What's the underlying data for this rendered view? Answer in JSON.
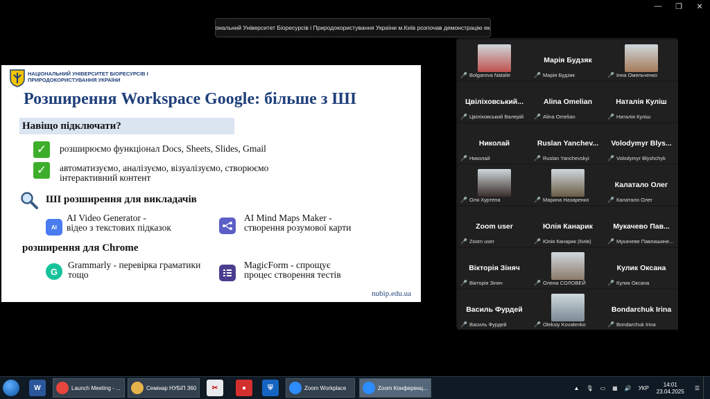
{
  "window": {
    "minimize": "—",
    "restore": "❐",
    "close": "✕"
  },
  "share_banner": {
    "text": "Національний Університет Біоресурсів і Природокористування України м.Київ розпочав демонстрацію екрана"
  },
  "slide": {
    "university": "НАЦІОНАЛЬНИЙ УНІВЕРСИТЕТ БІОРЕСУРСІВ І ПРИРОДОКОРИСТУВАННЯ УКРАЇНИ",
    "title": "Розширення Workspace Google: більше з ШІ",
    "why_heading": "Навіщо підключати?",
    "bullets": [
      {
        "text": "розширюємо функціонал Docs, Sheets, Slides, Gmail"
      },
      {
        "text": "автоматизуємо, аналізуємо, візуалізуємо, створюємо інтерактивний контент"
      }
    ],
    "teachers_heading": "ШІ розширення для викладачів",
    "extensions": [
      {
        "name": "AI Video Generator -",
        "desc": "відео з текстових підказок",
        "icon": "AI"
      },
      {
        "name": "AI Mind Maps Maker -",
        "desc": "створення розумової карти",
        "icon": "map"
      }
    ],
    "chrome_heading": "розширення для Chrome",
    "chrome_extensions": [
      {
        "name": "Grammarly - перевірка граматики",
        "desc": "тощо",
        "icon": "G"
      },
      {
        "name": "MagicForm - спрощує",
        "desc": "процес створення тестів",
        "icon": "form"
      }
    ],
    "url": "nubip.edu.ua",
    "accent_color": "#1f3f7a"
  },
  "gallery": {
    "participants": [
      {
        "name": "",
        "label": "Bolgarova Natalie",
        "photo": true,
        "photo_color": "#c0504d"
      },
      {
        "name": "Марія Будзяк",
        "label": "Марія Будзяк",
        "photo": false
      },
      {
        "name": "",
        "label": "Інна Омельченко",
        "photo": true,
        "photo_color": "#a57a5a"
      },
      {
        "name": "Цвіліховський...",
        "label": "Цвіліховський Валерій",
        "photo": false
      },
      {
        "name": "Alina Omelian",
        "label": "Alina Omelian",
        "photo": false
      },
      {
        "name": "Наталія Куліш",
        "label": "Наталія Куліш",
        "photo": false
      },
      {
        "name": "Николай",
        "label": "Николай",
        "photo": false
      },
      {
        "name": "Ruslan Yanchev...",
        "label": "Ruslan Yanchevskyi",
        "photo": false
      },
      {
        "name": "Volodymyr Blys...",
        "label": "Volodymyr Blyshchyk",
        "photo": false
      },
      {
        "name": "",
        "label": "Оля Хуртепа",
        "photo": true,
        "photo_color": "#3a2e2a"
      },
      {
        "name": "",
        "label": "Марина Назаренко",
        "photo": true,
        "photo_color": "#6b5b45"
      },
      {
        "name": "Калатало Олег",
        "label": "Калатало Олег",
        "photo": false
      },
      {
        "name": "Zoom user",
        "label": "Zoom user",
        "photo": false
      },
      {
        "name": "Юлія Канарик",
        "label": "Юлія Канарик (Київ)",
        "photo": false
      },
      {
        "name": "Мукачево Пав...",
        "label": "Мукачеве Павлишине...",
        "photo": false
      },
      {
        "name": "Вікторія Зіняч",
        "label": "Вікторія Зіняч",
        "photo": false
      },
      {
        "name": "",
        "label": "Олена СОЛОВЕЙ",
        "photo": true,
        "photo_color": "#8c7a6a"
      },
      {
        "name": "Кулик Оксана",
        "label": "Кулик Оксана",
        "photo": false
      },
      {
        "name": "Василь Фурдей",
        "label": "Василь Фурдей",
        "photo": false
      },
      {
        "name": "",
        "label": "Oleksiy Kovalenko",
        "photo": true,
        "photo_color": "#7a8a96"
      },
      {
        "name": "Bondarchuk Irina",
        "label": "Bondarchuk Irina",
        "photo": false
      }
    ]
  },
  "taskbar": {
    "buttons": [
      {
        "label": "Launch Meeting - ...",
        "icon": "chrome-icon",
        "color": "#e8453c",
        "active": false
      },
      {
        "label": "Семінар НУБіП 360",
        "icon": "folder-icon",
        "color": "#e6b34a",
        "active": false
      },
      {
        "label": "Zoom Workplace",
        "icon": "zoom-icon",
        "color": "#2d8cff",
        "active": false
      },
      {
        "label": "Zoom Конференц...",
        "icon": "zoom-icon",
        "color": "#2d8cff",
        "active": true
      }
    ],
    "language": "УКР",
    "time": "14:01",
    "date": "23.04.2025"
  }
}
